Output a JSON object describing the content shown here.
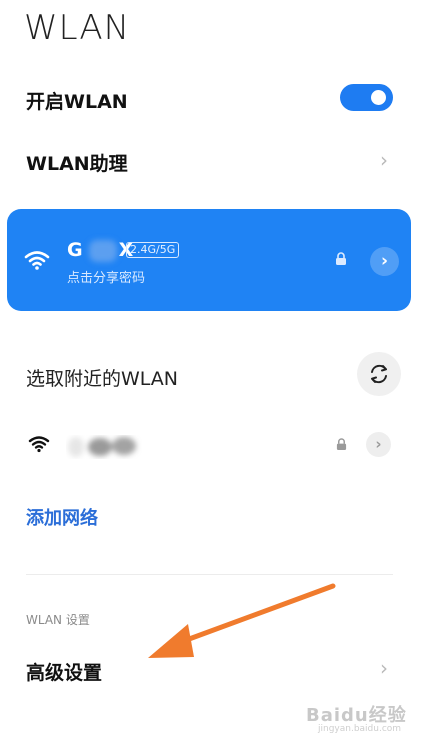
{
  "header": {
    "title": "WLAN"
  },
  "toggle_row": {
    "label": "开启WLAN",
    "state": "on"
  },
  "assistant_row": {
    "label": "WLAN助理"
  },
  "connected_network": {
    "name_start": "G",
    "name_end": "X",
    "band": "2.4G/5G",
    "subtitle": "点击分享密码"
  },
  "nearby": {
    "title": "选取附近的WLAN"
  },
  "add_network": {
    "label": "添加网络"
  },
  "settings": {
    "caption": "WLAN 设置",
    "advanced_label": "高级设置"
  },
  "watermark": {
    "text": "Baidu经验",
    "sub": "jingyan.baidu.com"
  },
  "colors": {
    "accent": "#1f83f4",
    "toggle": "#1e7cf2",
    "link": "#2b6ed8",
    "annotation_arrow": "#f07b2d"
  }
}
